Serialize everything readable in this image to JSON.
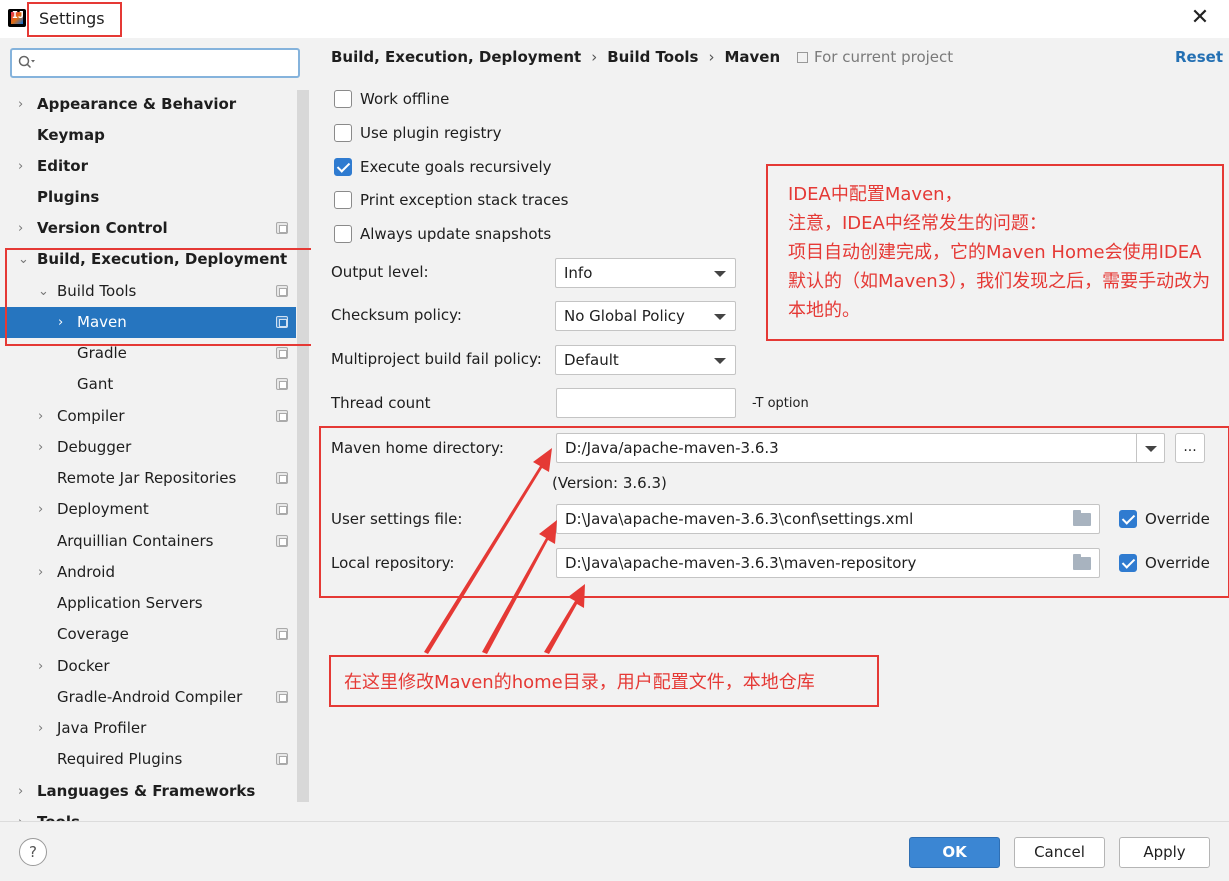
{
  "window": {
    "title": "Settings"
  },
  "sidebar": {
    "search_placeholder": "",
    "items": [
      {
        "label": "Appearance & Behavior",
        "chevron": "›",
        "bold": true
      },
      {
        "label": "Keymap",
        "chevron": "",
        "bold": true
      },
      {
        "label": "Editor",
        "chevron": "›",
        "bold": true
      },
      {
        "label": "Plugins",
        "chevron": "",
        "bold": true
      },
      {
        "label": "Version Control",
        "chevron": "›",
        "bold": true
      },
      {
        "label": "Build, Execution, Deployment",
        "chevron": "⌄",
        "bold": true
      },
      {
        "label": "Build Tools",
        "chevron": "⌄",
        "bold": false
      },
      {
        "label": "Maven",
        "chevron": "›",
        "bold": false
      },
      {
        "label": "Gradle",
        "chevron": "",
        "bold": false
      },
      {
        "label": "Gant",
        "chevron": "",
        "bold": false
      },
      {
        "label": "Compiler",
        "chevron": "›",
        "bold": false
      },
      {
        "label": "Debugger",
        "chevron": "›",
        "bold": false
      },
      {
        "label": "Remote Jar Repositories",
        "chevron": "",
        "bold": false
      },
      {
        "label": "Deployment",
        "chevron": "›",
        "bold": false
      },
      {
        "label": "Arquillian Containers",
        "chevron": "",
        "bold": false
      },
      {
        "label": "Android",
        "chevron": "›",
        "bold": false
      },
      {
        "label": "Application Servers",
        "chevron": "",
        "bold": false
      },
      {
        "label": "Coverage",
        "chevron": "",
        "bold": false
      },
      {
        "label": "Docker",
        "chevron": "›",
        "bold": false
      },
      {
        "label": "Gradle-Android Compiler",
        "chevron": "",
        "bold": false
      },
      {
        "label": "Java Profiler",
        "chevron": "›",
        "bold": false
      },
      {
        "label": "Required Plugins",
        "chevron": "",
        "bold": false
      },
      {
        "label": "Languages & Frameworks",
        "chevron": "›",
        "bold": true
      },
      {
        "label": "Tools",
        "chevron": "›",
        "bold": true
      }
    ],
    "selected": "Maven"
  },
  "breadcrumb": {
    "parts": [
      "Build, Execution, Deployment",
      "Build Tools",
      "Maven"
    ],
    "separator": "›",
    "scope": "For current project",
    "reset": "Reset"
  },
  "options": {
    "work_offline": {
      "label": "Work offline",
      "checked": false
    },
    "use_plugin_registry": {
      "label": "Use plugin registry",
      "checked": false
    },
    "execute_goals_recursively": {
      "label": "Execute goals recursively",
      "checked": true
    },
    "print_exception": {
      "label": "Print exception stack traces",
      "checked": false
    },
    "always_update": {
      "label": "Always update snapshots",
      "checked": false
    }
  },
  "form": {
    "output_level": {
      "label": "Output level:",
      "value": "Info"
    },
    "checksum_policy": {
      "label": "Checksum policy:",
      "value": "No Global Policy"
    },
    "fail_policy": {
      "label": "Multiproject build fail policy:",
      "value": "Default"
    },
    "thread_count": {
      "label": "Thread count",
      "value": "",
      "hint": "-T option"
    },
    "maven_home": {
      "label": "Maven home directory:",
      "value": "D:/Java/apache-maven-3.6.3",
      "browse": "...",
      "version": "(Version: 3.6.3)"
    },
    "user_settings": {
      "label": "User settings file:",
      "value": "D:\\Java\\apache-maven-3.6.3\\conf\\settings.xml",
      "override_label": "Override",
      "override": true
    },
    "local_repo": {
      "label": "Local repository:",
      "value": "D:\\Java\\apache-maven-3.6.3\\maven-repository",
      "override_label": "Override",
      "override": true
    }
  },
  "annotations": {
    "note1": [
      "IDEA中配置Maven，",
      "注意，IDEA中经常发生的问题：",
      "项目自动创建完成，它的Maven Home会使用IDEA默认的（如Maven3），我们发现之后，需要手动改为本地的。"
    ],
    "note2": "在这里修改Maven的home目录，用户配置文件，本地仓库",
    "color": "#e53935"
  },
  "buttons": {
    "ok": "OK",
    "cancel": "Cancel",
    "apply": "Apply",
    "help": "?"
  },
  "colors": {
    "accent": "#2675bf",
    "selection": "#2675bf",
    "ok_button": "#3b86d3",
    "link": "#2470b3"
  }
}
